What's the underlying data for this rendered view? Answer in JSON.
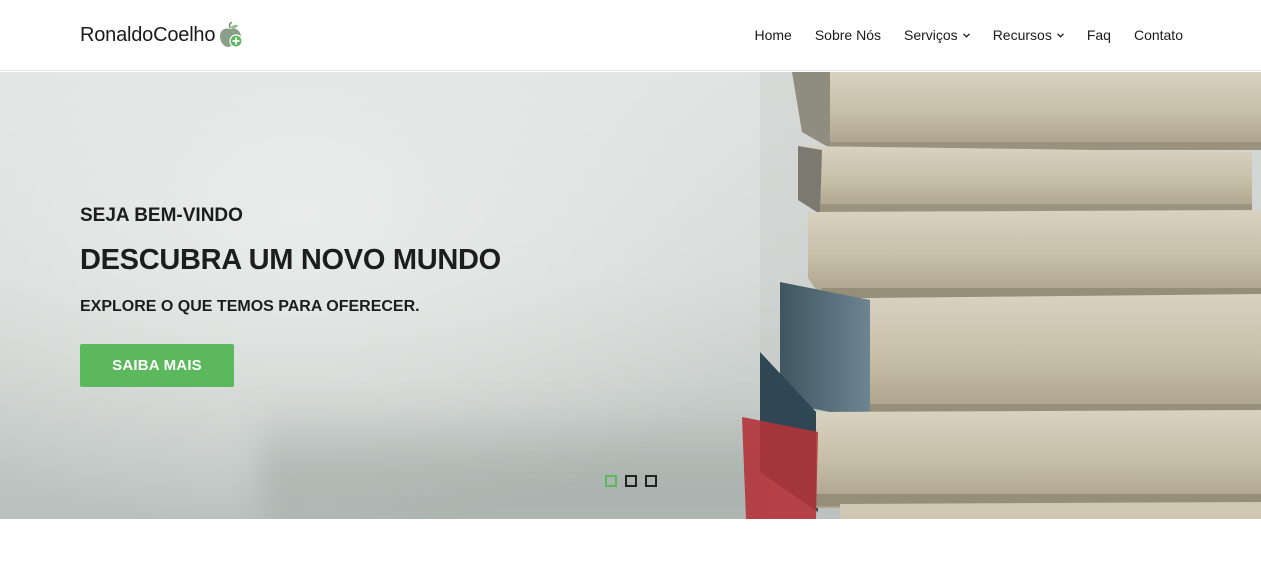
{
  "brand": {
    "name": "RonaldoCoelho",
    "icon": "green-apple-plus-icon"
  },
  "nav": {
    "items": [
      {
        "label": "Home",
        "dropdown": false
      },
      {
        "label": "Sobre Nós",
        "dropdown": false
      },
      {
        "label": "Serviços",
        "dropdown": true
      },
      {
        "label": "Recursos",
        "dropdown": true
      },
      {
        "label": "Faq",
        "dropdown": false
      },
      {
        "label": "Contato",
        "dropdown": false
      }
    ]
  },
  "hero": {
    "kicker": "SEJA BEM-VINDO",
    "headline": "DESCUBRA UM NOVO MUNDO",
    "subline": "EXPLORE O QUE TEMOS PARA OFERECER.",
    "cta_label": "SAIBA MAIS",
    "slides_count": 3,
    "active_slide": 1
  },
  "colors": {
    "accent": "#5cb85c",
    "text": "#1b1b1b",
    "header_bg": "#ffffff"
  }
}
